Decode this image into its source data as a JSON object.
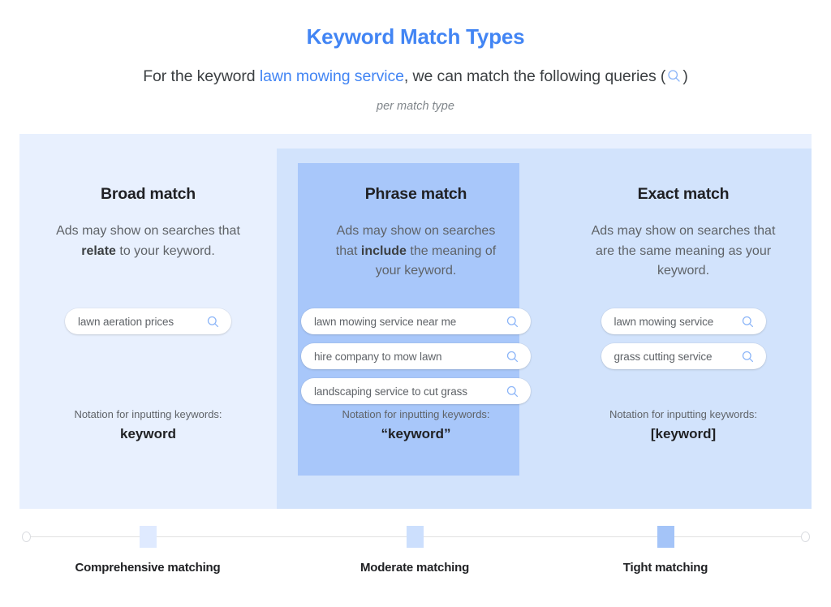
{
  "header": {
    "title": "Keyword Match Types",
    "subtitle_pre": "For the keyword ",
    "subtitle_keyword": "lawn mowing service",
    "subtitle_post": ", we can match the following queries (",
    "subtitle_end": ")",
    "sub_note": "per match type",
    "search_icon": "search-icon",
    "title_color": "#4285f4",
    "keyword_color": "#4285f4"
  },
  "columns": [
    {
      "title": "Broad match",
      "desc_pre": "Ads may show on searches that ",
      "desc_bold": "relate",
      "desc_post": " to your keyword.",
      "queries": [
        "lawn aeration prices"
      ],
      "notation_label": "Notation for inputting keywords:",
      "notation_value": "keyword",
      "panel_color": "#e8f0fe"
    },
    {
      "title": "Phrase match",
      "desc_pre": "Ads may show on searches that ",
      "desc_bold": "include",
      "desc_post": " the meaning of your keyword.",
      "queries": [
        "lawn mowing service near me",
        "hire company to mow lawn",
        "landscaping service to cut grass"
      ],
      "notation_label": "Notation for inputting keywords:",
      "notation_value": "“keyword”",
      "panel_color": "#d2e3fc"
    },
    {
      "title": "Exact match",
      "desc_pre": "Ads may show on searches that are the same meaning as your keyword.",
      "desc_bold": "",
      "desc_post": "",
      "queries": [
        "lawn mowing service",
        "grass cutting service"
      ],
      "notation_label": "Notation for inputting keywords:",
      "notation_value": "[keyword]",
      "panel_color": "#a8c7fa"
    }
  ],
  "scale": {
    "labels": [
      "Comprehensive matching",
      "Moderate matching",
      "Tight matching"
    ],
    "marker_colors": [
      "#dfeaff",
      "#ccdffd",
      "#a4c4f8"
    ],
    "track_color": "#e0e0e0"
  }
}
